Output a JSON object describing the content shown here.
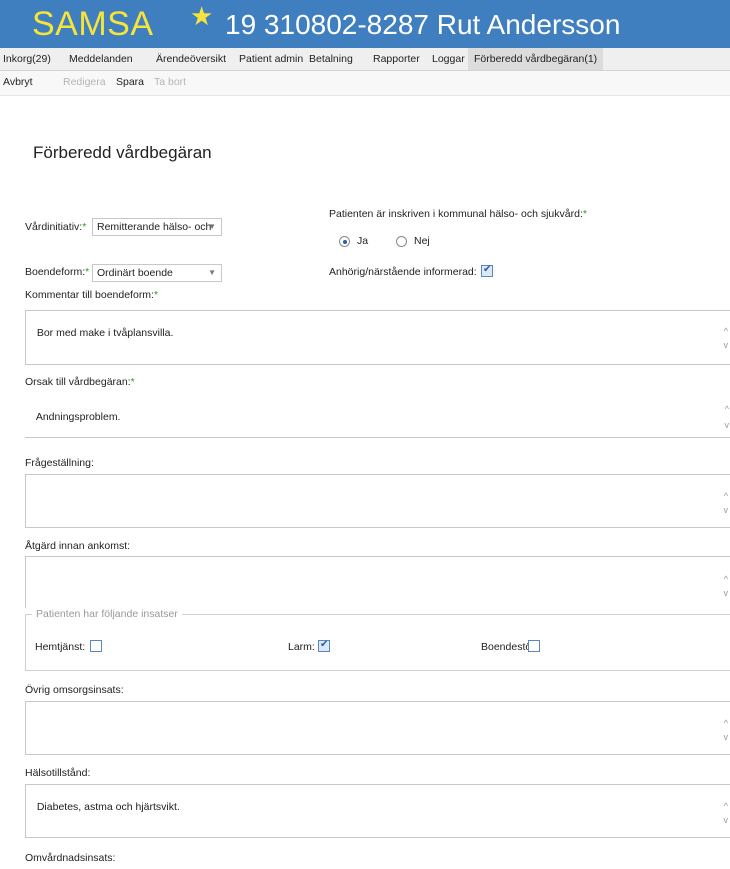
{
  "header": {
    "logo": "SAMSA",
    "patient": "19 310802-8287 Rut Andersson"
  },
  "nav": {
    "tabs": [
      {
        "label": "Inkorg(29)"
      },
      {
        "label": "Meddelanden"
      },
      {
        "label": "Ärendeöversikt"
      },
      {
        "label": "Patient admin"
      },
      {
        "label": "Betalning"
      },
      {
        "label": "Rapporter"
      },
      {
        "label": "Loggar"
      },
      {
        "label": "Förberedd vårdbegäran(1)",
        "active": true
      }
    ]
  },
  "toolbar": {
    "cancel": "Avbryt",
    "edit": "Redigera",
    "save": "Spara",
    "delete": "Ta bort"
  },
  "page_title": "Förberedd vårdbegäran",
  "form": {
    "vardinitiativ_label": "Vårdinitiativ:",
    "vardinitiativ_value": "Remitterande hälso- och",
    "required_mark": "*",
    "inskriven_label": "Patienten är inskriven i kommunal hälso- och sjukvård:",
    "radio_ja": "Ja",
    "radio_nej": "Nej",
    "inskriven_selected": "Ja",
    "boendeform_label": "Boendeform:",
    "boendeform_value": "Ordinärt boende",
    "anhorig_label": "Anhörig/närstående informerad:",
    "anhorig_checked": true,
    "kommentar_label": "Kommentar till boendeform:",
    "kommentar_value": "Bor med make i tvåplansvilla.",
    "orsak_label": "Orsak till vårdbegäran:",
    "orsak_value": "Andningsproblem.",
    "fragestallning_label": "Frågeställning:",
    "fragestallning_value": "",
    "atgard_label": "Åtgärd innan ankomst:",
    "atgard_value": "",
    "insatser_legend": "Patienten har följande insatser",
    "hemtjanst_label": "Hemtjänst:",
    "hemtjanst_checked": false,
    "larm_label": "Larm:",
    "larm_checked": true,
    "boendestod_label": "Boendestöd:",
    "boendestod_checked": false,
    "ovrig_label": "Övrig omsorgsinsats:",
    "ovrig_value": "",
    "halsotillstand_label": "Hälsotillstånd:",
    "halsotillstand_value": "Diabetes, astma och hjärtsvikt.",
    "omvardnad_label": "Omvårdnadsinsats:"
  },
  "icons": {
    "favorite": "star-icon",
    "dropdown": "chevron-down-icon",
    "scroll_up": "chevron-up-icon",
    "scroll_down": "chevron-down-icon"
  },
  "colors": {
    "header_bg": "#3f7fc0",
    "logo": "#f7e43a",
    "required": "#2a9a2a",
    "checkbox_border": "#5a86c4"
  }
}
